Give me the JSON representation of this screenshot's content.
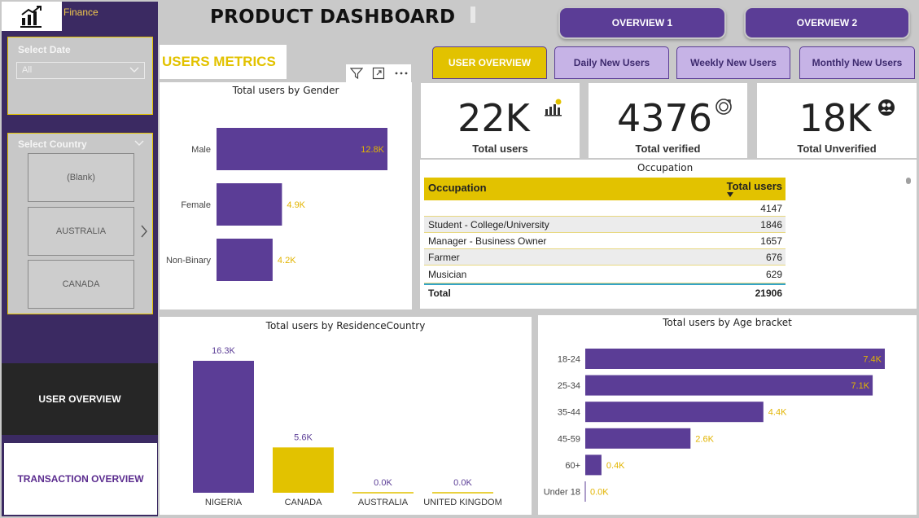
{
  "app": {
    "brand": "Finance",
    "title": "PRODUCT DASHBOARD"
  },
  "header_buttons": [
    "OVERVIEW 1",
    "OVERVIEW 2"
  ],
  "section_label": "USERS METRICS",
  "tabs": [
    {
      "label": "USER OVERVIEW",
      "active": true
    },
    {
      "label": "Daily New Users",
      "active": false
    },
    {
      "label": "Weekly New Users",
      "active": false
    },
    {
      "label": "Monthly New Users",
      "active": false
    }
  ],
  "slicers": {
    "date": {
      "title": "Select Date",
      "value": "All"
    },
    "country": {
      "title": "Select Country",
      "options": [
        "(Blank)",
        "AUSTRALIA",
        "CANADA"
      ]
    }
  },
  "nav": {
    "user_overview": "USER OVERVIEW",
    "transaction_overview": "TRANSACTION OVERVIEW"
  },
  "kpis": [
    {
      "value": "22K",
      "label": "Total users",
      "icon": "chart-growth-icon"
    },
    {
      "value": "4376",
      "label": "Total verified",
      "icon": "verified-refresh-icon"
    },
    {
      "value": "18K",
      "label": "Total Unverified",
      "icon": "user-group-icon"
    }
  ],
  "occupation_table": {
    "title": "Occupation",
    "columns": [
      "Occupation",
      "Total users"
    ],
    "rows": [
      [
        "",
        "4147"
      ],
      [
        "Student - College/University",
        "1846"
      ],
      [
        "Manager - Business Owner",
        "1657"
      ],
      [
        "Farmer",
        "676"
      ],
      [
        "Musician",
        "629"
      ]
    ],
    "total_label": "Total",
    "total_value": "21906"
  },
  "colors": {
    "purple": "#5b3d96",
    "yellow": "#e2c200",
    "label_yellow": "#e2b400",
    "sidebar": "#3b2a62"
  },
  "chart_data": [
    {
      "type": "bar",
      "orientation": "horizontal",
      "title": "Total users by Gender",
      "categories": [
        "Male",
        "Female",
        "Non-Binary"
      ],
      "values": [
        12800,
        4900,
        4200
      ],
      "labels": [
        "12.8K",
        "4.9K",
        "4.2K"
      ]
    },
    {
      "type": "bar",
      "orientation": "vertical",
      "title": "Total users by ResidenceCountry",
      "categories": [
        "NIGERIA",
        "CANADA",
        "AUSTRALIA",
        "UNITED KINGDOM"
      ],
      "values": [
        16300,
        5600,
        0,
        0
      ],
      "labels": [
        "16.3K",
        "5.6K",
        "0.0K",
        "0.0K"
      ],
      "bar_colors": [
        "#5b3d96",
        "#e2c200",
        "#e2c200",
        "#e2c200"
      ]
    },
    {
      "type": "bar",
      "orientation": "horizontal",
      "title": "Total users by Age bracket",
      "categories": [
        "18-24",
        "25-34",
        "35-44",
        "45-59",
        "60+",
        "Under 18"
      ],
      "values": [
        7400,
        7100,
        4400,
        2600,
        400,
        0
      ],
      "labels": [
        "7.4K",
        "7.1K",
        "4.4K",
        "2.6K",
        "0.4K",
        "0.0K"
      ]
    }
  ]
}
